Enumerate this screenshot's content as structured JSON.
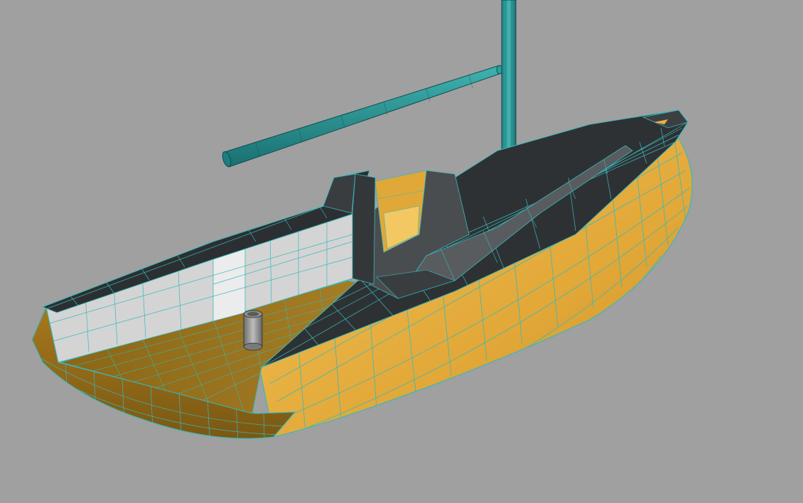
{
  "viewport": {
    "background_color": "#a0a0a0",
    "render_mode": "shaded-with-wireframe-overlay"
  },
  "model": {
    "parts": [
      {
        "name": "mast",
        "color": "#2aa0a0"
      },
      {
        "name": "boom",
        "color": "#2aa0a0"
      },
      {
        "name": "hull-topsides",
        "color": "#e8b040"
      },
      {
        "name": "deck",
        "color": "#2e3133"
      },
      {
        "name": "cockpit-floor",
        "color": "#9a7420"
      },
      {
        "name": "cabin-coaming",
        "color": "#3a3d40"
      },
      {
        "name": "transom-bulkhead",
        "color": "#d0d0d0"
      },
      {
        "name": "cockpit-winch",
        "color": "#8c8c8c"
      }
    ],
    "wireframe_color": "#39b8bc"
  }
}
